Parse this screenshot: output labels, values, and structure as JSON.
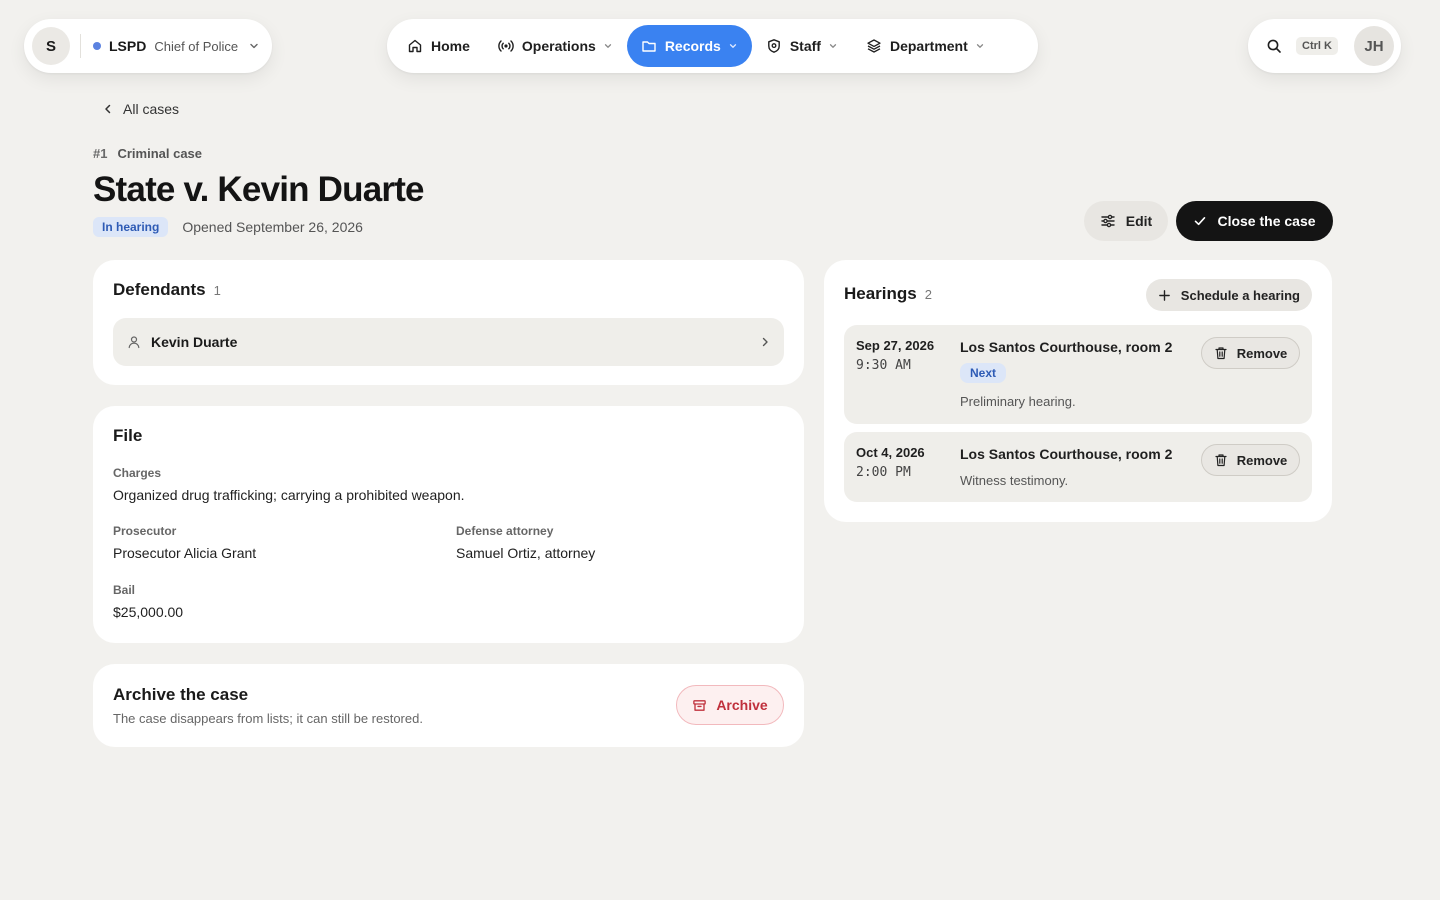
{
  "org": {
    "avatar_initial": "S",
    "name": "LSPD",
    "role": "Chief of Police"
  },
  "nav": {
    "items": [
      {
        "label": "Home",
        "icon": "home-icon",
        "dropdown": false,
        "active": false
      },
      {
        "label": "Operations",
        "icon": "broadcast-icon",
        "dropdown": true,
        "active": false
      },
      {
        "label": "Records",
        "icon": "folder-icon",
        "dropdown": true,
        "active": true
      },
      {
        "label": "Staff",
        "icon": "shield-icon",
        "dropdown": true,
        "active": false
      },
      {
        "label": "Department",
        "icon": "layers-icon",
        "dropdown": true,
        "active": false
      }
    ]
  },
  "tools": {
    "shortcut": "Ctrl K",
    "user_initials": "JH"
  },
  "case": {
    "back_label": "All cases",
    "number": "#1",
    "type": "Criminal case",
    "title": "State v. Kevin Duarte",
    "status": "In hearing",
    "opened": "Opened September 26, 2026",
    "edit_label": "Edit",
    "close_label": "Close the case"
  },
  "defendants": {
    "title": "Defendants",
    "count": "1",
    "items": [
      {
        "name": "Kevin Duarte"
      }
    ]
  },
  "file": {
    "title": "File",
    "charges_label": "Charges",
    "charges_value": "Organized drug trafficking; carrying a prohibited weapon.",
    "prosecutor_label": "Prosecutor",
    "prosecutor_value": "Prosecutor Alicia Grant",
    "defense_label": "Defense attorney",
    "defense_value": "Samuel Ortiz, attorney",
    "bail_label": "Bail",
    "bail_value": "$25,000.00"
  },
  "archive": {
    "title": "Archive the case",
    "description": "The case disappears from lists; it can still be restored.",
    "button_label": "Archive"
  },
  "hearings": {
    "title": "Hearings",
    "count": "2",
    "schedule_label": "Schedule a hearing",
    "remove_label": "Remove",
    "items": [
      {
        "date": "Sep 27, 2026",
        "time": "9:30 AM",
        "location": "Los Santos Courthouse, room 2",
        "badge": "Next",
        "note": "Preliminary hearing."
      },
      {
        "date": "Oct 4, 2026",
        "time": "2:00 PM",
        "location": "Los Santos Courthouse, room 2",
        "note": "Witness testimony."
      }
    ]
  },
  "colors": {
    "accent": "#3a82f1",
    "background": "#f2f1ee",
    "danger": "#c0303c",
    "status_badge_bg": "#dce6f8"
  }
}
